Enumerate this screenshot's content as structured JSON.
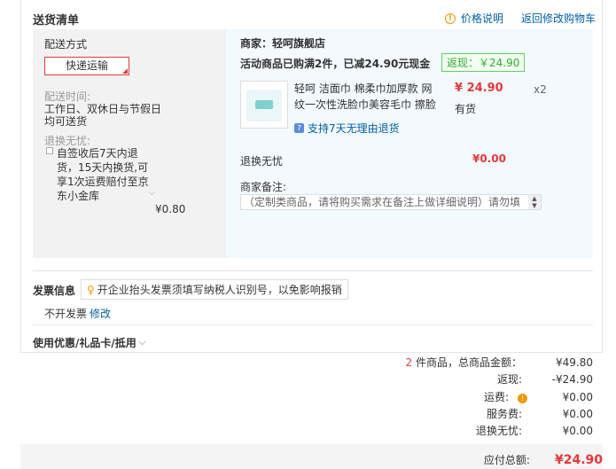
{
  "section": {
    "title": "送货清单"
  },
  "top_links": {
    "price_note": "价格说明",
    "back_cart": "返回修改购物车"
  },
  "delivery": {
    "method_label": "配送方式",
    "method_value": "快递运输",
    "time_label": "配送时间:",
    "time_value_1": "工作日、双休日与节假日",
    "time_value_2": "均可送货",
    "return_label": "退换无忧:",
    "return_option_1": "自签收后7天内退",
    "return_option_2": "货，15天内换货,可",
    "return_option_3": "享1次运费赔付至京",
    "return_option_4": "东小金库",
    "return_fee": "¥0.80"
  },
  "shop": {
    "name": "商家：轻呵旗舰店",
    "promo": "活动商品已购满2件，已减24.90元现金",
    "promo_tag": "返现：￥24.90",
    "product_name": "轻呵 洁面巾 棉柔巾加厚款 网纹一次性洗脸巾美容毛巾 擦脸",
    "price": "¥ 24.90",
    "qty": "x2",
    "stock": "有货",
    "return_text": "支持7天无理由退货",
    "nofee_label": "退换无忧",
    "nofee_price": "¥0.00",
    "remark_label": "商家备注:",
    "remark_placeholder": "（定制类商品，请将购买需求在备注上做详细说明）请勿填"
  },
  "invoice": {
    "title": "发票信息",
    "tip": "开企业抬头发票须填写纳税人识别号，以免影响报销",
    "value": "不开发票",
    "edit": "修改"
  },
  "coupon": {
    "label": "使用优惠/礼品卡/抵用"
  },
  "summary": {
    "count": "2",
    "count_label": " 件商品，总商品金额：",
    "total": "¥49.80",
    "cashback_label": "返现:",
    "cashback": "-¥24.90",
    "shipping_label": "运费:",
    "shipping": "¥0.00",
    "service_label": "服务费:",
    "service": "¥0.00",
    "nofee_label": "退换无忧:",
    "nofee": "¥0.00",
    "pay_label": "应付总额:",
    "pay": "¥24.90"
  }
}
